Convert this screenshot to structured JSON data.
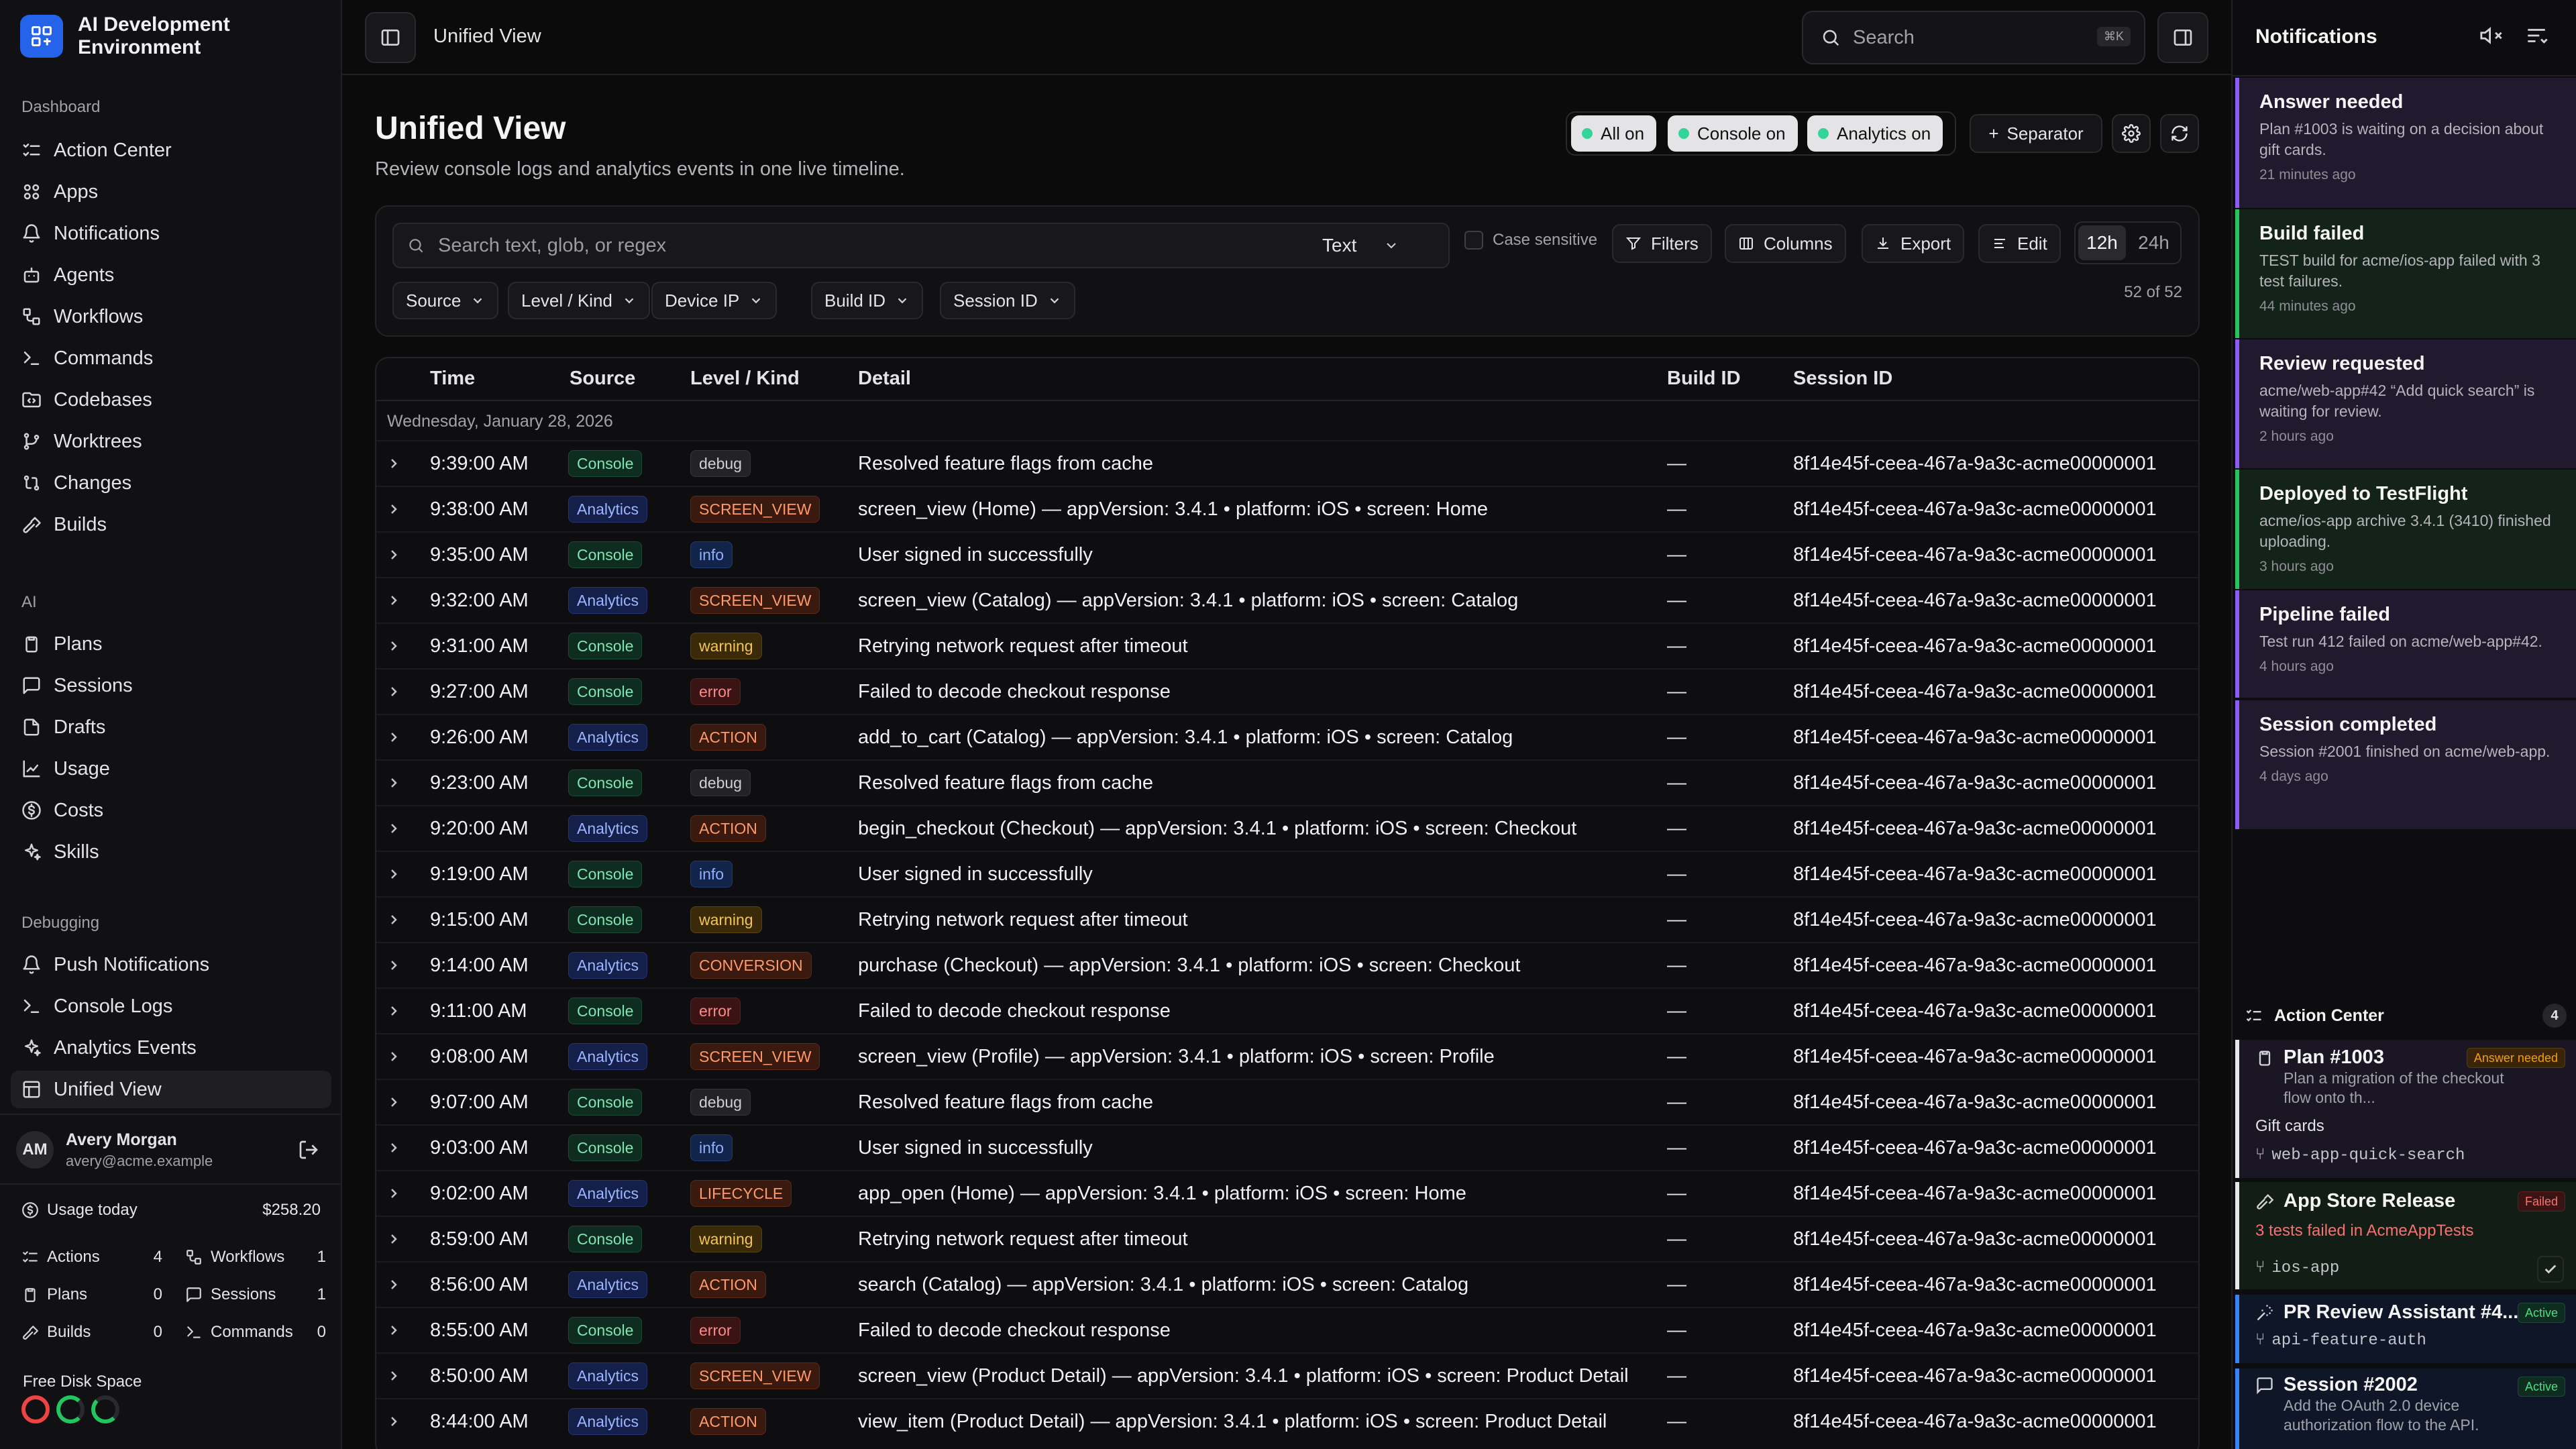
{
  "app": {
    "title": "AI Development Environment"
  },
  "sidebar": {
    "sections": [
      {
        "label": "Dashboard",
        "items": [
          {
            "label": "Action Center",
            "icon": "list-checks-icon"
          },
          {
            "label": "Apps",
            "icon": "apps-icon"
          },
          {
            "label": "Notifications",
            "icon": "bell-icon"
          },
          {
            "label": "Agents",
            "icon": "bot-icon"
          },
          {
            "label": "Workflows",
            "icon": "workflow-icon"
          },
          {
            "label": "Commands",
            "icon": "terminal-icon"
          },
          {
            "label": "Codebases",
            "icon": "folder-code-icon"
          },
          {
            "label": "Worktrees",
            "icon": "git-branch-icon"
          },
          {
            "label": "Changes",
            "icon": "git-compare-icon"
          },
          {
            "label": "Builds",
            "icon": "hammer-icon"
          }
        ]
      },
      {
        "label": "AI",
        "items": [
          {
            "label": "Plans",
            "icon": "clipboard-icon"
          },
          {
            "label": "Sessions",
            "icon": "chat-icon"
          },
          {
            "label": "Drafts",
            "icon": "file-icon"
          },
          {
            "label": "Usage",
            "icon": "chart-icon"
          },
          {
            "label": "Costs",
            "icon": "dollar-icon"
          },
          {
            "label": "Skills",
            "icon": "sparkles-icon"
          }
        ]
      },
      {
        "label": "Debugging",
        "items": [
          {
            "label": "Push Notifications",
            "icon": "bell-icon"
          },
          {
            "label": "Console Logs",
            "icon": "terminal-icon"
          },
          {
            "label": "Analytics Events",
            "icon": "sparkles-icon"
          },
          {
            "label": "Unified View",
            "icon": "layout-icon",
            "active": true
          }
        ]
      }
    ],
    "user": {
      "initials": "AM",
      "name": "Avery Morgan",
      "email": "avery@acme.example"
    },
    "usage": {
      "label": "Usage today",
      "value": "$258.20"
    },
    "stats": [
      {
        "label": "Actions",
        "value": "4"
      },
      {
        "label": "Workflows",
        "value": "1"
      },
      {
        "label": "Plans",
        "value": "0"
      },
      {
        "label": "Sessions",
        "value": "1"
      },
      {
        "label": "Builds",
        "value": "0"
      },
      {
        "label": "Commands",
        "value": "0"
      }
    ],
    "disk": {
      "label": "Free Disk Space",
      "colors": [
        "#ef4444",
        "#22c55e",
        "#22c55e"
      ]
    }
  },
  "topbar": {
    "breadcrumb": "Unified View",
    "search_placeholder": "Search",
    "shortcut": "⌘K"
  },
  "main": {
    "title": "Unified View",
    "subtitle": "Review console logs and analytics events in one live timeline.",
    "toggles": [
      "All on",
      "Console on",
      "Analytics on"
    ],
    "separator_label": "Separator",
    "filter": {
      "placeholder": "Search text, glob, or regex",
      "mode": "Text",
      "case_label": "Case sensitive",
      "filters_label": "Filters",
      "columns_label": "Columns",
      "export_label": "Export",
      "edit_label": "Edit",
      "range": [
        "12h",
        "24h"
      ],
      "chips": [
        "Source",
        "Level / Kind",
        "Device IP",
        "Build ID",
        "Session ID"
      ],
      "count": "52 of 52"
    },
    "columns": [
      "Time",
      "Source",
      "Level / Kind",
      "Detail",
      "Build ID",
      "Session ID"
    ],
    "group_date": "Wednesday, January 28, 2026",
    "rows": [
      {
        "time": "9:39:00 AM",
        "source": "Console",
        "level": "debug",
        "detail": "Resolved feature flags from cache",
        "build": "—",
        "session": "8f14e45f-ceea-467a-9a3c-acme00000001"
      },
      {
        "time": "9:38:00 AM",
        "source": "Analytics",
        "level": "SCREEN_VIEW",
        "detail": "screen_view (Home) — appVersion: 3.4.1 • platform: iOS • screen: Home",
        "build": "—",
        "session": "8f14e45f-ceea-467a-9a3c-acme00000001"
      },
      {
        "time": "9:35:00 AM",
        "source": "Console",
        "level": "info",
        "detail": "User signed in successfully",
        "build": "—",
        "session": "8f14e45f-ceea-467a-9a3c-acme00000001"
      },
      {
        "time": "9:32:00 AM",
        "source": "Analytics",
        "level": "SCREEN_VIEW",
        "detail": "screen_view (Catalog) — appVersion: 3.4.1 • platform: iOS • screen: Catalog",
        "build": "—",
        "session": "8f14e45f-ceea-467a-9a3c-acme00000001"
      },
      {
        "time": "9:31:00 AM",
        "source": "Console",
        "level": "warning",
        "detail": "Retrying network request after timeout",
        "build": "—",
        "session": "8f14e45f-ceea-467a-9a3c-acme00000001"
      },
      {
        "time": "9:27:00 AM",
        "source": "Console",
        "level": "error",
        "detail": "Failed to decode checkout response",
        "build": "—",
        "session": "8f14e45f-ceea-467a-9a3c-acme00000001"
      },
      {
        "time": "9:26:00 AM",
        "source": "Analytics",
        "level": "ACTION",
        "detail": "add_to_cart (Catalog) — appVersion: 3.4.1 • platform: iOS • screen: Catalog",
        "build": "—",
        "session": "8f14e45f-ceea-467a-9a3c-acme00000001"
      },
      {
        "time": "9:23:00 AM",
        "source": "Console",
        "level": "debug",
        "detail": "Resolved feature flags from cache",
        "build": "—",
        "session": "8f14e45f-ceea-467a-9a3c-acme00000001"
      },
      {
        "time": "9:20:00 AM",
        "source": "Analytics",
        "level": "ACTION",
        "detail": "begin_checkout (Checkout) — appVersion: 3.4.1 • platform: iOS • screen: Checkout",
        "build": "—",
        "session": "8f14e45f-ceea-467a-9a3c-acme00000001"
      },
      {
        "time": "9:19:00 AM",
        "source": "Console",
        "level": "info",
        "detail": "User signed in successfully",
        "build": "—",
        "session": "8f14e45f-ceea-467a-9a3c-acme00000001"
      },
      {
        "time": "9:15:00 AM",
        "source": "Console",
        "level": "warning",
        "detail": "Retrying network request after timeout",
        "build": "—",
        "session": "8f14e45f-ceea-467a-9a3c-acme00000001"
      },
      {
        "time": "9:14:00 AM",
        "source": "Analytics",
        "level": "CONVERSION",
        "detail": "purchase (Checkout) — appVersion: 3.4.1 • platform: iOS • screen: Checkout",
        "build": "—",
        "session": "8f14e45f-ceea-467a-9a3c-acme00000001"
      },
      {
        "time": "9:11:00 AM",
        "source": "Console",
        "level": "error",
        "detail": "Failed to decode checkout response",
        "build": "—",
        "session": "8f14e45f-ceea-467a-9a3c-acme00000001"
      },
      {
        "time": "9:08:00 AM",
        "source": "Analytics",
        "level": "SCREEN_VIEW",
        "detail": "screen_view (Profile) — appVersion: 3.4.1 • platform: iOS • screen: Profile",
        "build": "—",
        "session": "8f14e45f-ceea-467a-9a3c-acme00000001"
      },
      {
        "time": "9:07:00 AM",
        "source": "Console",
        "level": "debug",
        "detail": "Resolved feature flags from cache",
        "build": "—",
        "session": "8f14e45f-ceea-467a-9a3c-acme00000001"
      },
      {
        "time": "9:03:00 AM",
        "source": "Console",
        "level": "info",
        "detail": "User signed in successfully",
        "build": "—",
        "session": "8f14e45f-ceea-467a-9a3c-acme00000001"
      },
      {
        "time": "9:02:00 AM",
        "source": "Analytics",
        "level": "LIFECYCLE",
        "detail": "app_open (Home) — appVersion: 3.4.1 • platform: iOS • screen: Home",
        "build": "—",
        "session": "8f14e45f-ceea-467a-9a3c-acme00000001"
      },
      {
        "time": "8:59:00 AM",
        "source": "Console",
        "level": "warning",
        "detail": "Retrying network request after timeout",
        "build": "—",
        "session": "8f14e45f-ceea-467a-9a3c-acme00000001"
      },
      {
        "time": "8:56:00 AM",
        "source": "Analytics",
        "level": "ACTION",
        "detail": "search (Catalog) — appVersion: 3.4.1 • platform: iOS • screen: Catalog",
        "build": "—",
        "session": "8f14e45f-ceea-467a-9a3c-acme00000001"
      },
      {
        "time": "8:55:00 AM",
        "source": "Console",
        "level": "error",
        "detail": "Failed to decode checkout response",
        "build": "—",
        "session": "8f14e45f-ceea-467a-9a3c-acme00000001"
      },
      {
        "time": "8:50:00 AM",
        "source": "Analytics",
        "level": "SCREEN_VIEW",
        "detail": "screen_view (Product Detail) — appVersion: 3.4.1 • platform: iOS • screen: Product Detail",
        "build": "—",
        "session": "8f14e45f-ceea-467a-9a3c-acme00000001"
      },
      {
        "time": "8:44:00 AM",
        "source": "Analytics",
        "level": "ACTION",
        "detail": "view_item (Product Detail) — appVersion: 3.4.1 • platform: iOS • screen: Product Detail",
        "build": "—",
        "session": "8f14e45f-ceea-467a-9a3c-acme00000001"
      }
    ]
  },
  "notifications": {
    "title": "Notifications",
    "items": [
      {
        "title": "Answer needed",
        "desc": "Plan #1003 is waiting on a decision about gift cards.",
        "when": "21 minutes ago",
        "tone": "purple"
      },
      {
        "title": "Build failed",
        "desc": "TEST build for acme/ios-app failed with 3 test failures.",
        "when": "44 minutes ago",
        "tone": "green"
      },
      {
        "title": "Review requested",
        "desc": "acme/web-app#42 “Add quick search” is waiting for review.",
        "when": "2 hours ago",
        "tone": "purple"
      },
      {
        "title": "Deployed to TestFlight",
        "desc": "acme/ios-app archive 3.4.1 (3410) finished uploading.",
        "when": "3 hours ago",
        "tone": "green"
      },
      {
        "title": "Pipeline failed",
        "desc": "Test run 412 failed on acme/web-app#42.",
        "when": "4 hours ago",
        "tone": "purple"
      },
      {
        "title": "Session completed",
        "desc": "Session #2001 finished on acme/web-app.",
        "when": "4 days ago",
        "tone": "purple"
      }
    ],
    "action_center": {
      "title": "Action Center",
      "count": "4",
      "cards": [
        {
          "title": "Plan #1003",
          "tag": "Answer needed",
          "desc": "Plan a migration of the checkout flow onto th...",
          "extra": "Gift cards",
          "branch": "web-app-quick-search"
        },
        {
          "title": "App Store Release",
          "tag": "Failed",
          "desc": "3 tests failed in AcmeAppTests",
          "branch": "ios-app"
        },
        {
          "title": "PR Review Assistant #4...",
          "tag": "Active",
          "branch": "api-feature-auth"
        },
        {
          "title": "Session #2002",
          "tag": "Active",
          "desc": "Add the OAuth 2.0 device authorization flow to the API."
        }
      ]
    }
  }
}
